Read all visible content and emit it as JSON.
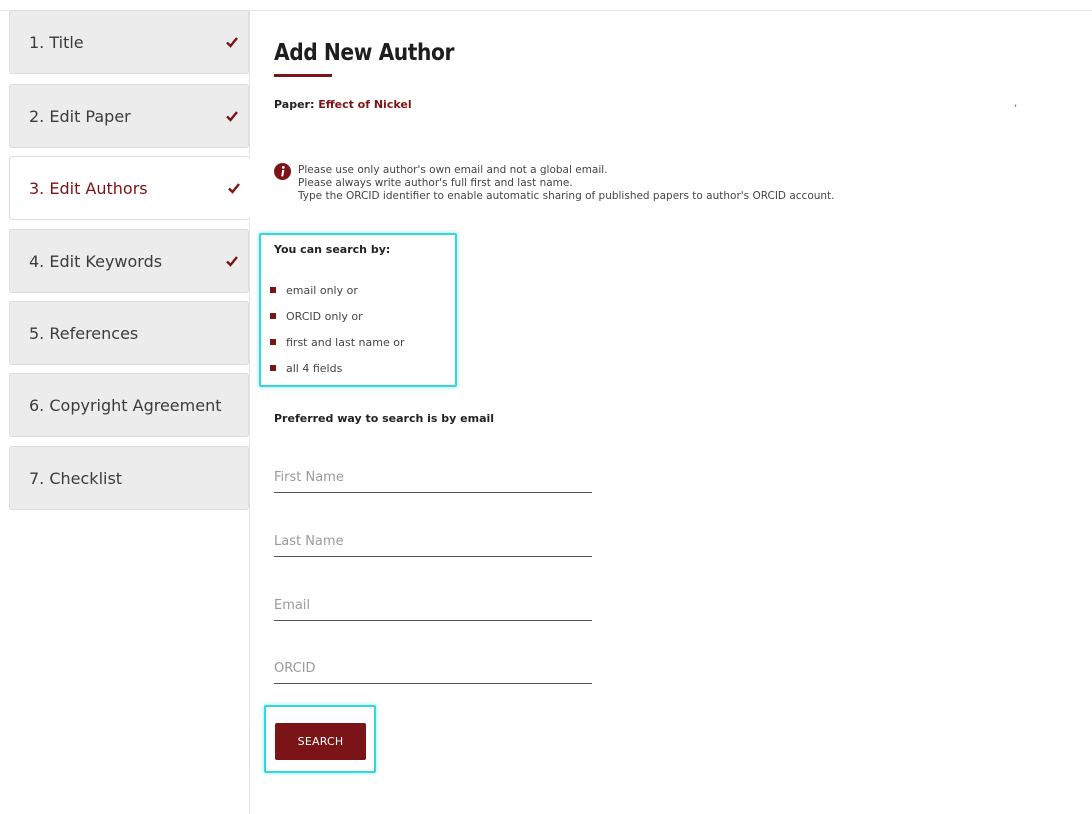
{
  "sidebar": {
    "steps": [
      {
        "label": "1. Title",
        "done": true
      },
      {
        "label": "2. Edit Paper",
        "done": true
      },
      {
        "label": "3. Edit Authors",
        "done": true,
        "active": true
      },
      {
        "label": "4. Edit Keywords",
        "done": true
      },
      {
        "label": "5. References",
        "done": false
      },
      {
        "label": "6. Copyright Agreement",
        "done": false
      },
      {
        "label": "7. Checklist",
        "done": false
      }
    ]
  },
  "main": {
    "title": "Add New Author",
    "paper_prefix": "Paper: ",
    "paper_title": "Effect of Nickel",
    "stray_mark": ",",
    "notes": [
      "Please use only author's own email and not a global email.",
      "Please always write author's full first and last name.",
      "Type the ORCID identifier to enable automatic sharing of published papers to author's ORCID account."
    ],
    "search_by_title": "You can search by:",
    "search_options": [
      "email only or",
      "ORCID only or",
      "first and last name or",
      "all 4 fields"
    ],
    "preferred": "Preferred way to search is by email",
    "fields": {
      "first_name_placeholder": "First Name",
      "last_name_placeholder": "Last Name",
      "email_placeholder": "Email",
      "orcid_placeholder": "ORCID"
    },
    "search_button": "SEARCH"
  },
  "colors": {
    "accent": "#7b1416",
    "highlight": "#36d6e0",
    "sidebar_bg": "#ececec"
  },
  "icons": {
    "step_done": "checkmark-icon",
    "info": "info-icon"
  }
}
